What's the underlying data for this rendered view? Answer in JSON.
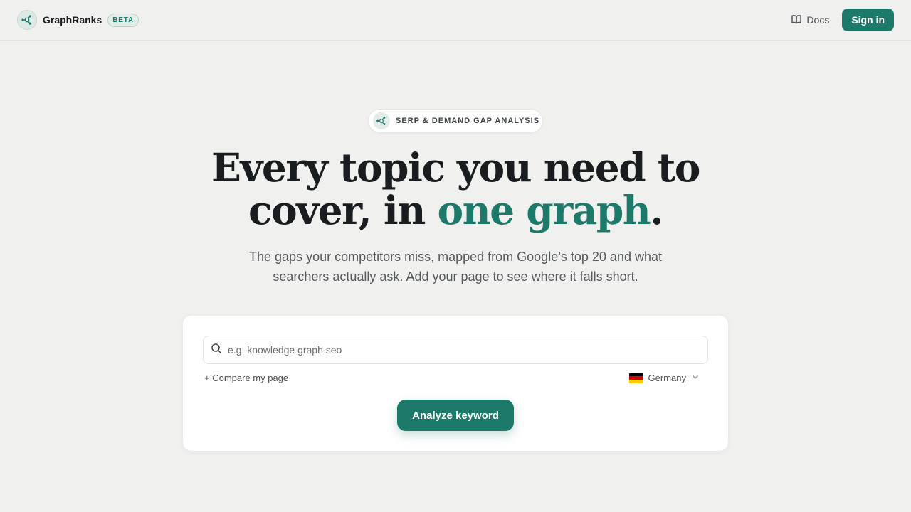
{
  "header": {
    "brand_name": "GraphRanks",
    "beta_label": "BETA",
    "docs_label": "Docs",
    "signin_label": "Sign in"
  },
  "hero": {
    "pill_label": "SERP & DEMAND GAP ANALYSIS",
    "headline_line1": "Every topic you need to",
    "headline_line2_prefix": "cover, in ",
    "headline_accent": "one graph",
    "headline_suffix": ".",
    "subline_line1": "The gaps your competitors miss, mapped from Google’s top 20 and what",
    "subline_line2": "searchers actually ask. Add your page to see where it falls short."
  },
  "search": {
    "placeholder": "e.g. knowledge graph seo",
    "value": "",
    "compare_label": "+ Compare my page",
    "country": "Germany",
    "submit_label": "Analyze keyword"
  },
  "colors": {
    "accent": "#1d7a6a",
    "background": "#f0f0ee",
    "card": "#ffffff"
  },
  "icons": {
    "brand": "graph-network-icon",
    "docs": "book-open-icon",
    "search": "search-icon",
    "country_flag": "germany-flag-icon",
    "dropdown": "chevron-down-icon"
  }
}
